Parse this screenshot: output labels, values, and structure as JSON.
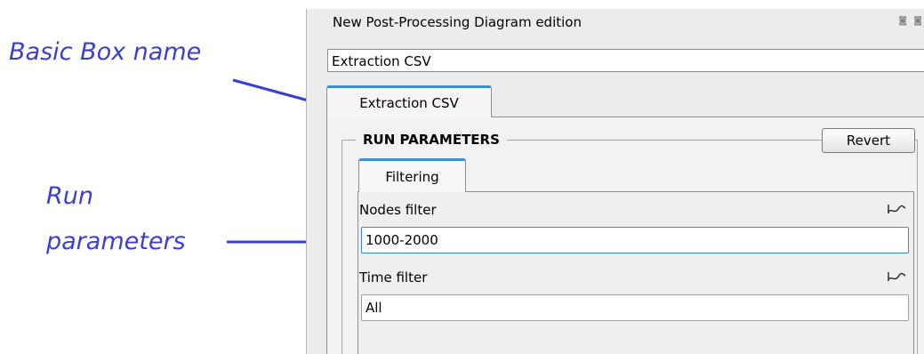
{
  "annotations": {
    "basic_box": "Basic Box name",
    "run_line1": "Run",
    "run_line2": "parameters"
  },
  "panel": {
    "title": "New Post-Processing Diagram edition",
    "window_controls": "◙ ◙",
    "name_value": "Extraction CSV",
    "tab_label": "Extraction CSV"
  },
  "run_parameters": {
    "group_title": "RUN PARAMETERS",
    "revert_label": "Revert",
    "subtab_label": "Filtering",
    "nodes_filter_label": "Nodes filter",
    "nodes_filter_value": "1000-2000",
    "time_filter_label": "Time filter",
    "time_filter_value": "All",
    "curve_icon": "curve-icon"
  },
  "colors": {
    "annotation": "#3a3fcf",
    "tab_accent": "#3f8ed8"
  }
}
